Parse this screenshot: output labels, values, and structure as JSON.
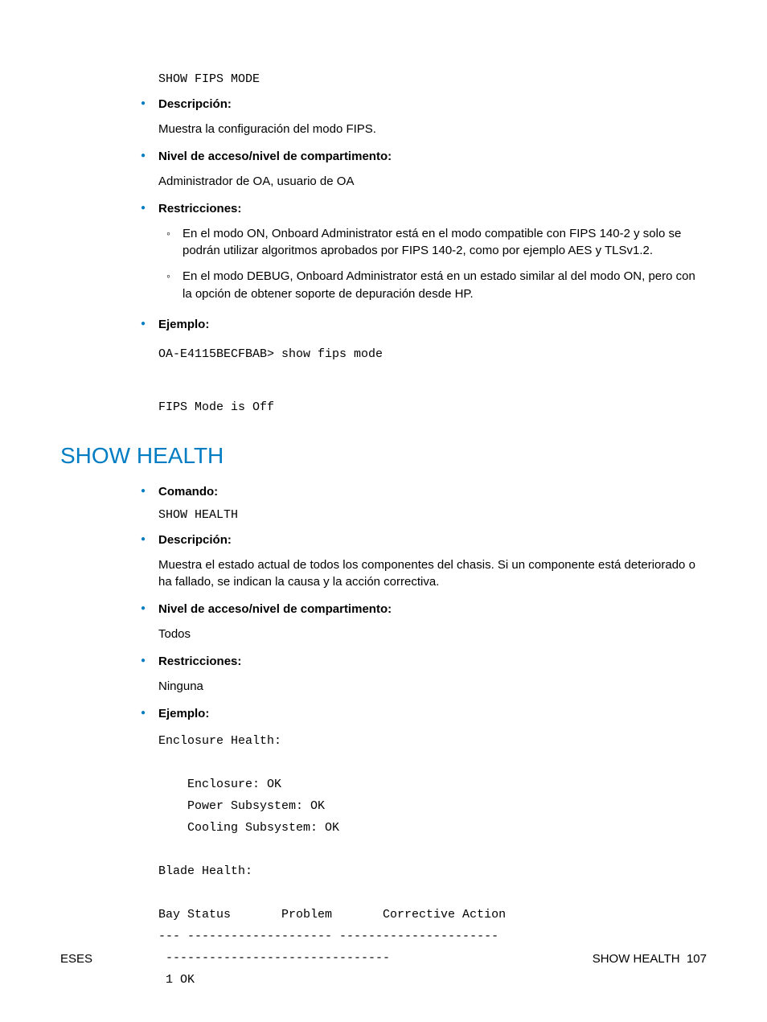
{
  "section1": {
    "cmd": "SHOW FIPS MODE",
    "desc_label": "Descripción:",
    "desc_text": "Muestra la configuración del modo FIPS.",
    "access_label": "Nivel de acceso/nivel de compartimento:",
    "access_text": "Administrador de OA, usuario de OA",
    "restr_label": "Restricciones:",
    "restr1": "En el modo ON, Onboard Administrator está en el modo compatible con FIPS 140-2 y solo se podrán utilizar algoritmos aprobados por FIPS 140-2, como por ejemplo AES y TLSv1.2.",
    "restr2": "En el modo DEBUG, Onboard Administrator está en un estado similar al del modo ON, pero con la opción de obtener soporte de depuración desde HP.",
    "ex_label": "Ejemplo:",
    "ex_line1": "OA-E4115BECFBAB> show fips mode",
    "ex_line2": "FIPS Mode is Off"
  },
  "heading": "SHOW HEALTH",
  "section2": {
    "cmd_label": "Comando:",
    "cmd": "SHOW HEALTH",
    "desc_label": "Descripción:",
    "desc_text": "Muestra el estado actual de todos los componentes del chasis. Si un componente está deteriorado o ha fallado, se indican la causa y la acción correctiva.",
    "access_label": "Nivel de acceso/nivel de compartimento:",
    "access_text": "Todos",
    "restr_label": "Restricciones:",
    "restr_text": "Ninguna",
    "ex_label": "Ejemplo:",
    "ex_block": "Enclosure Health:\n\n    Enclosure: OK\n    Power Subsystem: OK\n    Cooling Subsystem: OK\n\nBlade Health:\n\nBay Status       Problem       Corrective Action\n--- -------------------- ----------------------\n -------------------------------\n 1 OK"
  },
  "footer": {
    "left": "ESES",
    "right_label": "SHOW HEALTH",
    "right_page": "107"
  }
}
